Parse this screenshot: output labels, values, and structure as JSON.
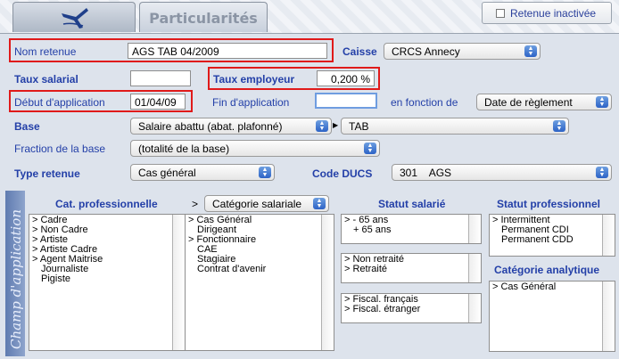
{
  "tabs": {
    "tab2_label": "Particularités"
  },
  "retenue_inactivee": {
    "label": "Retenue inactivée"
  },
  "form": {
    "nom_retenue": {
      "label": "Nom retenue",
      "value": "AGS TAB 04/2009"
    },
    "caisse": {
      "label": "Caisse",
      "value": "CRCS Annecy"
    },
    "taux_salarial": {
      "label": "Taux salarial",
      "value": ""
    },
    "taux_employeur": {
      "label": "Taux employeur",
      "value": "0,200 %"
    },
    "debut_application": {
      "label": "Début d'application",
      "value": "01/04/09"
    },
    "fin_application": {
      "label": "Fin d'application",
      "value": ""
    },
    "en_fonction_de": {
      "label": "en fonction de",
      "value": "Date de règlement"
    },
    "base": {
      "label": "Base",
      "value": "Salaire abattu (abat. plafonné)",
      "secondary": "TAB"
    },
    "fraction_base": {
      "label": "Fraction de la base",
      "value": "(totalité de la base)"
    },
    "type_retenue": {
      "label": "Type retenue",
      "value": "Cas général"
    },
    "code_ducs": {
      "label": "Code DUCS",
      "value": "301    AGS"
    }
  },
  "champ": {
    "band_label": "Champ d'application",
    "cat_pro": {
      "header": "Cat. professionnelle",
      "items": [
        "> Cadre",
        "> Non Cadre",
        "> Artiste",
        "> Artiste Cadre",
        "> Agent Maitrise",
        "Journaliste",
        "Pigiste"
      ]
    },
    "cat_sal": {
      "arrow": ">",
      "select": "Catégorie salariale",
      "items": [
        "> Cas Général",
        "Dirigeant",
        "> Fonctionnaire",
        "CAE",
        "Stagiaire",
        "Contrat d'avenir"
      ]
    },
    "statut_salarie": {
      "header": "Statut salarié",
      "age": [
        "> - 65 ans",
        "+ 65 ans"
      ],
      "retraite": [
        "> Non retraité",
        "> Retraité"
      ],
      "fiscal": [
        "> Fiscal. français",
        "> Fiscal. étranger"
      ]
    },
    "statut_pro": {
      "header": "Statut professionnel",
      "items": [
        "> Intermittent",
        "Permanent CDI",
        "Permanent CDD"
      ]
    },
    "cat_analytique": {
      "header": "Catégorie analytique",
      "items": [
        "> Cas Général"
      ]
    }
  },
  "colors": {
    "label_blue": "#2440a8",
    "highlight_red": "#e01a1a",
    "panel_bg": "#dde3ec"
  },
  "icons": [
    "pen-icon",
    "chevron-updown-icon"
  ]
}
